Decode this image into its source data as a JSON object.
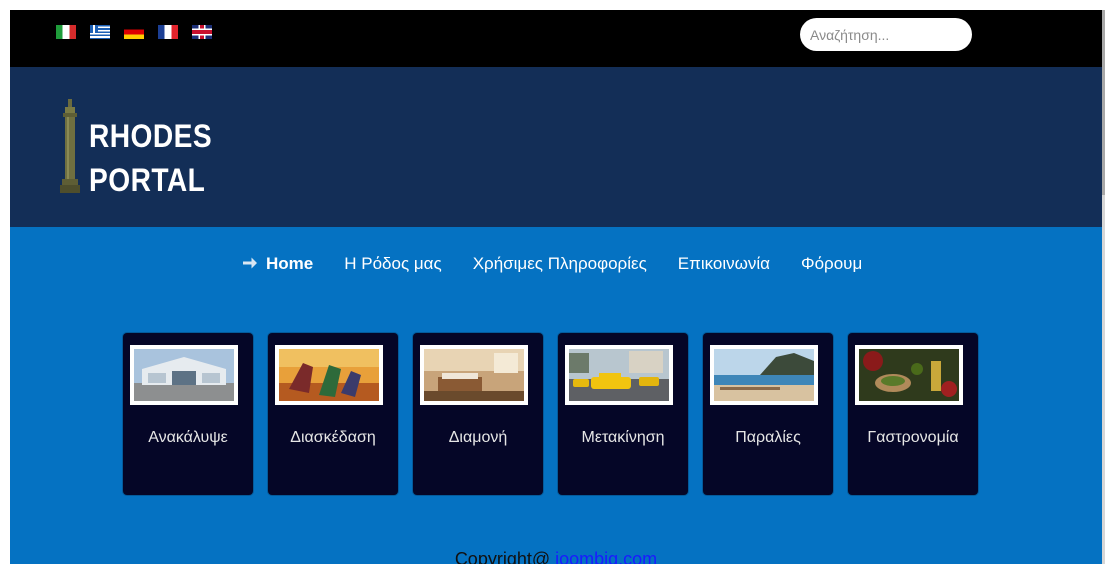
{
  "topbar": {
    "flags": [
      {
        "name": "italian-flag-icon",
        "lang": "Italian"
      },
      {
        "name": "greek-flag-icon",
        "lang": "Greek"
      },
      {
        "name": "german-flag-icon",
        "lang": "German"
      },
      {
        "name": "french-flag-icon",
        "lang": "French"
      },
      {
        "name": "uk-flag-icon",
        "lang": "English"
      }
    ],
    "search": {
      "placeholder": "Αναζήτηση...",
      "value": ""
    }
  },
  "header": {
    "logo_line1": "RHODES",
    "logo_line2": "PORTAL",
    "logo_icon": "column-icon",
    "background": "#132e57"
  },
  "nav": {
    "items": [
      {
        "label": "Home",
        "active": true
      },
      {
        "label": "Η Ρόδος μας",
        "active": false
      },
      {
        "label": "Χρήσιμες Πληροφορίες",
        "active": false
      },
      {
        "label": "Επικοινωνία",
        "active": false
      },
      {
        "label": "Φόρουμ",
        "active": false
      }
    ],
    "active_icon": "arrow-right-icon"
  },
  "cards": [
    {
      "label": "Ανακάλυψε",
      "image": "building-photo"
    },
    {
      "label": "Διασκέδαση",
      "image": "sunset-party-photo"
    },
    {
      "label": "Διαμονή",
      "image": "hotel-room-photo"
    },
    {
      "label": "Μετακίνηση",
      "image": "taxi-photo"
    },
    {
      "label": "Παραλίες",
      "image": "beach-photo"
    },
    {
      "label": "Γαστρονομία",
      "image": "food-photo"
    }
  ],
  "footer": {
    "text": "Copyright@ ",
    "link": "joombig.com"
  },
  "colors": {
    "topbar": "#000000",
    "main": "#0572c2",
    "card": "#050627"
  }
}
